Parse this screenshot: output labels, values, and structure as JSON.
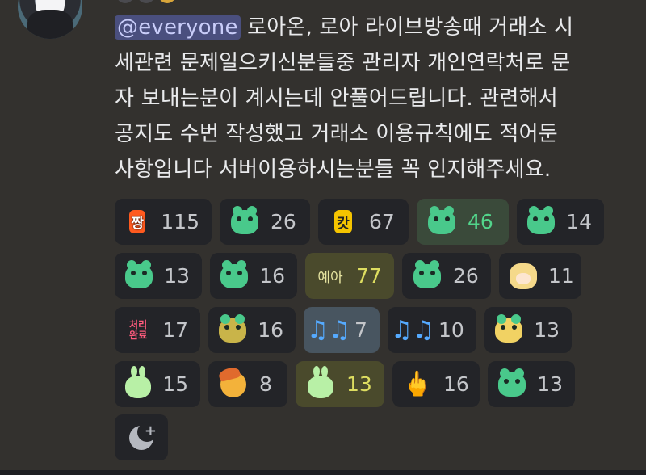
{
  "message": {
    "mention": "@everyone",
    "text": " 로아온, 로아 라이브방송때 거래소 시세관련 문제일으키신분들중 관리자 개인연락처로 문자 보내는분이 계시는데 안풀어드립니다. 관련해서 공지도 수번 작성했고 거래소 이용규칙에도 적어둔 사항입니다 서버이용하시는분들 꼭 인지해주세요.",
    "line1": " 로아온, 로아 라이브방송때 거래소 시",
    "line2": "세관련 문제일으키신분들중 관리자 개인연락처로 문",
    "line3": "자 보내는분이 계시는데 안풀어드립니다. 관련해서",
    "line4": "공지도 수번 작성했고 거래소 이용규칙에도 적어둔",
    "line5": "사항입니다 서버이용하시는분들 꼭 인지해주세요."
  },
  "reactions": [
    {
      "emoji": "jjang-icon",
      "label": "짱",
      "count": "115"
    },
    {
      "emoji": "frog-smile-icon",
      "count": "26"
    },
    {
      "emoji": "kat-icon",
      "label": "캇",
      "count": "67"
    },
    {
      "emoji": "frog-cheer-icon",
      "count": "46",
      "active": true
    },
    {
      "emoji": "frog-cheer-icon",
      "count": "14"
    },
    {
      "emoji": "frog-icon",
      "count": "13"
    },
    {
      "emoji": "frog-smirk-icon",
      "count": "16"
    },
    {
      "emoji": "yeah-icon",
      "label": "예아",
      "count": "77",
      "active": true
    },
    {
      "emoji": "frog-wink-icon",
      "count": "26"
    },
    {
      "emoji": "girl-icon",
      "count": "11"
    },
    {
      "emoji": "cheori-wanryo-icon",
      "label1": "처리",
      "label2": "완료",
      "count": "17"
    },
    {
      "emoji": "frog-hat-icon",
      "count": "16"
    },
    {
      "emoji": "music-notes-icon",
      "label": "♫♫",
      "count": "7",
      "active": true
    },
    {
      "emoji": "music-notes-icon",
      "label": "♫♫",
      "count": "10"
    },
    {
      "emoji": "duck-icon",
      "count": "13"
    },
    {
      "emoji": "bunny-icon",
      "count": "15"
    },
    {
      "emoji": "smiley-hat-icon",
      "count": "8"
    },
    {
      "emoji": "bunny-icon",
      "count": "13",
      "active": true
    },
    {
      "emoji": "middle-finger-icon",
      "label": "🖕",
      "count": "16"
    },
    {
      "emoji": "frog-laugh-icon",
      "count": "13"
    }
  ],
  "colors": {
    "background": "#33312e",
    "mention_bg": "#4a4f7e",
    "active_green": "#52d58b",
    "active_yellow": "#dddd60"
  }
}
